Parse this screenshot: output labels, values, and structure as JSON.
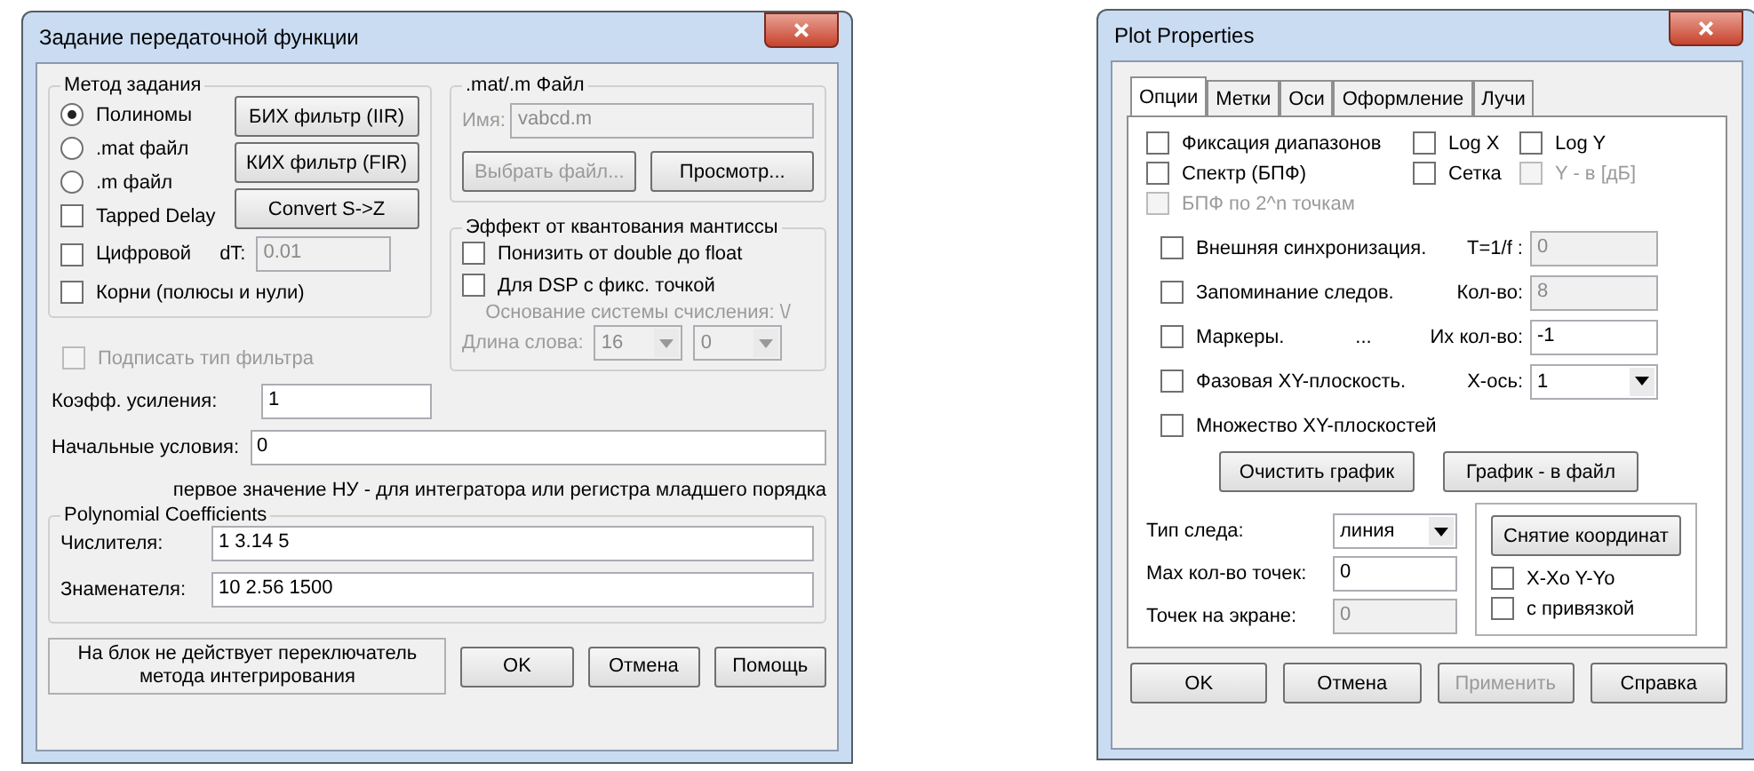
{
  "transfer": {
    "title": "Задание передаточной функции",
    "method": {
      "title": "Метод задания",
      "options": [
        {
          "label": "Полиномы",
          "selected": true
        },
        {
          "label": ".mat файл",
          "selected": false
        },
        {
          "label": ".m файл",
          "selected": false
        }
      ],
      "buttons": [
        "БИХ фильтр (IIR)",
        "КИХ фильтр (FIR)",
        "Convert S->Z"
      ],
      "tapped": {
        "label": "Tapped Delay",
        "checked": false
      },
      "digital": {
        "label": "Цифровой",
        "checked": false
      },
      "dt": {
        "label": "dT:",
        "value": "0.01",
        "disabled": true
      },
      "roots": {
        "label": "Корни (полюсы и нули)",
        "checked": false
      }
    },
    "file": {
      "title": ".mat/.m Файл",
      "name_label": "Имя:",
      "name_value": "vabcd.m",
      "disabled": true,
      "buttons": [
        {
          "label": "Выбрать файл...",
          "disabled": true
        },
        {
          "label": "Просмотр...",
          "disabled": false
        }
      ]
    },
    "quant": {
      "title": "Эффект от квантования мантиссы",
      "checks": [
        {
          "label": "Понизить от double до float",
          "checked": false
        },
        {
          "label": "Для DSP с фикс. точкой",
          "checked": false
        }
      ],
      "base_label": "Основание системы счисления: \\/",
      "length_label": "Длина слова:",
      "disabled": true,
      "selects": [
        "16",
        "0"
      ]
    },
    "sign": {
      "label": "Подписать тип фильтра",
      "checked": false,
      "disabled": true
    },
    "gain": {
      "label": "Коэфф. усиления:",
      "value": "1"
    },
    "initial": {
      "label": "Начальные условия:",
      "value": "0"
    },
    "note": "первое значение НУ - для интегратора или регистра младшего порядка",
    "poly": {
      "title": "Polynomial Coefficients",
      "rows": [
        {
          "label": "Числителя:",
          "value": "1 3.14 5"
        },
        {
          "label": "Знаменателя:",
          "value": "10 2.56 1500"
        }
      ]
    },
    "info": "На блок не действует переключатель метода интегрирования",
    "buttons": [
      "OK",
      "Отмена",
      "Помощь"
    ]
  },
  "plot": {
    "title": "Plot Properties",
    "tabs": [
      {
        "label": "Опции",
        "selected": true
      },
      {
        "label": "Метки",
        "selected": false
      },
      {
        "label": "Оси",
        "selected": false
      },
      {
        "label": "Оформление",
        "selected": false
      },
      {
        "label": "Лучи",
        "selected": false
      }
    ],
    "checks": [
      {
        "label": "Фиксация диапазонов",
        "checked": false,
        "disabled": false
      },
      {
        "label": "Log X",
        "checked": false,
        "disabled": false
      },
      {
        "label": "Log Y",
        "checked": false,
        "disabled": false
      },
      {
        "label": "Спектр (БПФ)",
        "checked": false,
        "disabled": false
      },
      {
        "label": "Сетка",
        "checked": false,
        "disabled": false
      },
      {
        "label": "Y - в [дБ]",
        "checked": false,
        "disabled": true
      },
      {
        "label": "БПФ по 2^n точкам",
        "checked": false,
        "disabled": true
      }
    ],
    "options": [
      {
        "label": "Внешняя синхронизация.",
        "checked": false,
        "field_label": "T=1/f :",
        "value": "0",
        "kind": "input",
        "disabled": true
      },
      {
        "label": "Запоминание следов.",
        "checked": false,
        "field_label": "Кол-во:",
        "value": "8",
        "kind": "input",
        "disabled": true
      },
      {
        "label": "Маркеры.",
        "extra": "...",
        "checked": false,
        "field_label": "Их кол-во:",
        "value": "-1",
        "kind": "input",
        "disabled": false
      },
      {
        "label": "Фазовая XY-плоскость.",
        "checked": false,
        "field_label": "X-ось:",
        "value": "1",
        "kind": "select",
        "disabled": false
      },
      {
        "label": "Множество XY-плоскостей",
        "checked": false,
        "kind": "none"
      }
    ],
    "actions": [
      "Очистить график",
      "График - в файл"
    ],
    "fields": [
      {
        "label": "Тип следа:",
        "value": "линия",
        "kind": "select",
        "disabled": false
      },
      {
        "label": "Max кол-во точек:",
        "value": "0",
        "kind": "input",
        "disabled": false
      },
      {
        "label": "Точек на экране:",
        "value": "0",
        "kind": "input",
        "disabled": true
      }
    ],
    "coord": {
      "button": "Снятие координат",
      "checks": [
        {
          "label": "X-Xo Y-Yo",
          "checked": false
        },
        {
          "label": "с привязкой",
          "checked": false
        }
      ]
    },
    "buttons": [
      {
        "label": "OK",
        "disabled": false
      },
      {
        "label": "Отмена",
        "disabled": false
      },
      {
        "label": "Применить",
        "disabled": true
      },
      {
        "label": "Справка",
        "disabled": false
      }
    ]
  }
}
